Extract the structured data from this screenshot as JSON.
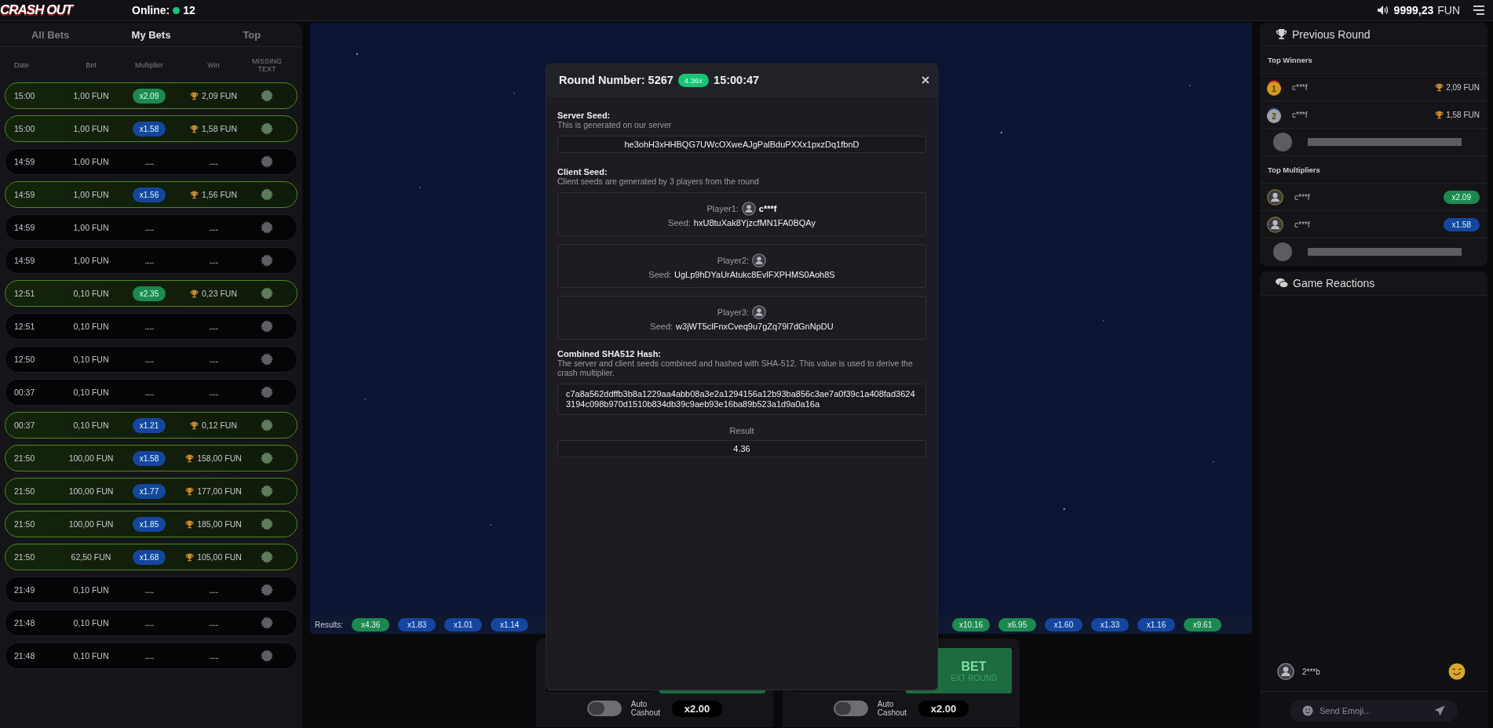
{
  "top_bar": {
    "logo": "CRASH OUT",
    "online_label": "Online:",
    "online_count": "12",
    "balance": "9999,23",
    "currency": "FUN"
  },
  "bets_panel": {
    "tabs": [
      {
        "label": "All Bets",
        "selected": false
      },
      {
        "label": "My Bets",
        "selected": true
      },
      {
        "label": "Top",
        "selected": false
      }
    ],
    "columns": [
      "Date",
      "Bet",
      "Multiplier",
      "Win",
      "MISSING TEXT"
    ],
    "rows": [
      {
        "date": "15:00",
        "bet": "1,00 FUN",
        "multiplier": "x2.09",
        "color": "#1c8a4f",
        "win": "2,09 FUN",
        "won": true
      },
      {
        "date": "15:00",
        "bet": "1,00 FUN",
        "multiplier": "x1.58",
        "color": "#1446a0",
        "win": "1,58 FUN",
        "won": true
      },
      {
        "date": "14:59",
        "bet": "1,00 FUN",
        "multiplier": "......",
        "win": "......",
        "won": false
      },
      {
        "date": "14:59",
        "bet": "1,00 FUN",
        "multiplier": "x1.56",
        "color": "#1446a0",
        "win": "1,56 FUN",
        "won": true
      },
      {
        "date": "14:59",
        "bet": "1,00 FUN",
        "multiplier": "......",
        "win": "......",
        "won": false
      },
      {
        "date": "14:59",
        "bet": "1,00 FUN",
        "multiplier": "......",
        "win": "......",
        "won": false
      },
      {
        "date": "12:51",
        "bet": "0,10 FUN",
        "multiplier": "x2.35",
        "color": "#1c8a4f",
        "win": "0,23 FUN",
        "won": true
      },
      {
        "date": "12:51",
        "bet": "0,10 FUN",
        "multiplier": "......",
        "win": "......",
        "won": false
      },
      {
        "date": "12:50",
        "bet": "0,10 FUN",
        "multiplier": "......",
        "win": "......",
        "won": false
      },
      {
        "date": "00:37",
        "bet": "0,10 FUN",
        "multiplier": "......",
        "win": "......",
        "won": false
      },
      {
        "date": "00:37",
        "bet": "0,10 FUN",
        "multiplier": "x1.21",
        "color": "#1446a0",
        "win": "0,12 FUN",
        "won": true
      },
      {
        "date": "21:50",
        "bet": "100,00 FUN",
        "multiplier": "x1.58",
        "color": "#1446a0",
        "win": "158,00 FUN",
        "won": true
      },
      {
        "date": "21:50",
        "bet": "100,00 FUN",
        "multiplier": "x1.77",
        "color": "#1446a0",
        "win": "177,00 FUN",
        "won": true
      },
      {
        "date": "21:50",
        "bet": "100,00 FUN",
        "multiplier": "x1.85",
        "color": "#1446a0",
        "win": "185,00 FUN",
        "won": true
      },
      {
        "date": "21:50",
        "bet": "62,50 FUN",
        "multiplier": "x1.68",
        "color": "#1446a0",
        "win": "105,00 FUN",
        "won": true
      },
      {
        "date": "21:49",
        "bet": "0,10 FUN",
        "multiplier": "......",
        "win": "......",
        "won": false
      },
      {
        "date": "21:48",
        "bet": "0,10 FUN",
        "multiplier": "......",
        "win": "......",
        "won": false
      },
      {
        "date": "21:48",
        "bet": "0,10 FUN",
        "multiplier": "......",
        "win": "......",
        "won": false
      }
    ]
  },
  "game": {
    "results_label": "Results:",
    "results_left": [
      {
        "value": "x4.36",
        "color": "#1c8a4f"
      },
      {
        "value": "x1.83",
        "color": "#1446a0"
      },
      {
        "value": "x1.01",
        "color": "#1446a0"
      },
      {
        "value": "x1.14",
        "color": "#1446a0"
      }
    ],
    "results_right": [
      {
        "value": "x10.16",
        "color": "#1c8a4f"
      },
      {
        "value": "x6.95",
        "color": "#1c8a4f"
      },
      {
        "value": "x1.60",
        "color": "#1446a0"
      },
      {
        "value": "x1.33",
        "color": "#1446a0"
      },
      {
        "value": "x1.16",
        "color": "#1446a0"
      },
      {
        "value": "x9.61",
        "color": "#1c8a4f"
      }
    ]
  },
  "bet_controls": [
    {
      "auto_on": false,
      "auto_label": "Auto Cashout",
      "cashout": "x2.00"
    },
    {
      "bet_label": "BET",
      "bet_sublabel": "EXT ROUND",
      "auto_on": false,
      "auto_label": "Auto Cashout",
      "cashout": "x2.00"
    }
  ],
  "previous_round": {
    "title": "Previous Round",
    "winners_title": "Top Winners",
    "winners": [
      {
        "rank": "1",
        "name": "c***f",
        "amount": "2,09 FUN"
      },
      {
        "rank": "2",
        "name": "c***f",
        "amount": "1,58 FUN"
      }
    ],
    "multipliers_title": "Top Multipliers",
    "multipliers": [
      {
        "name": "c***f",
        "multiplier": "x2.09",
        "color": "#1c8a4f"
      },
      {
        "name": "c***f",
        "multiplier": "x1.58",
        "color": "#1446a0"
      }
    ]
  },
  "reactions": {
    "title": "Game Reactions",
    "items": [
      {
        "user": "2***b"
      }
    ],
    "placeholder": "Send Emoji..."
  },
  "modal": {
    "title": "Round Number: 5267",
    "multiplier": "4.36x",
    "time": "15:00:47",
    "server_heading": "Server Seed:",
    "server_note": "This is generated on our server",
    "server_seed": "he3ohH3xHHBQG7UWcOXweAJgPalBduPXXx1pxzDq1fbnD",
    "client_heading": "Client Seed:",
    "client_note": "Client seeds are generated by 3 players from the round",
    "players": [
      {
        "label": "Player1:",
        "name": "c***f",
        "seed_label": "Seed:",
        "seed": "hxU8tuXak8YjzcfMN1FA0BQAy"
      },
      {
        "label": "Player2:",
        "seed_label": "Seed:",
        "seed": "UgLp9hDYaUrAtukc8EvlFXPHMS0Aoh8S"
      },
      {
        "label": "Player3:",
        "seed_label": "Seed:",
        "seed": "w3jWT5clFnxCveq9u7gZq79l7dGnNpDU"
      }
    ],
    "hash_heading": "Combined SHA512 Hash:",
    "hash_note": "The server and client seeds combined and hashed with SHA-512. This value is used to derive the crash multiplier.",
    "hash": "c7a8a562ddffb3b8a1229aa4abb08a3e2a1294156a12b93ba856c3ae7a0f39c1a408fad36243194c098b970d1510b834db39c9aeb93e16ba89b523a1d9a0a16a",
    "result_label": "Result",
    "result": "4.36"
  }
}
